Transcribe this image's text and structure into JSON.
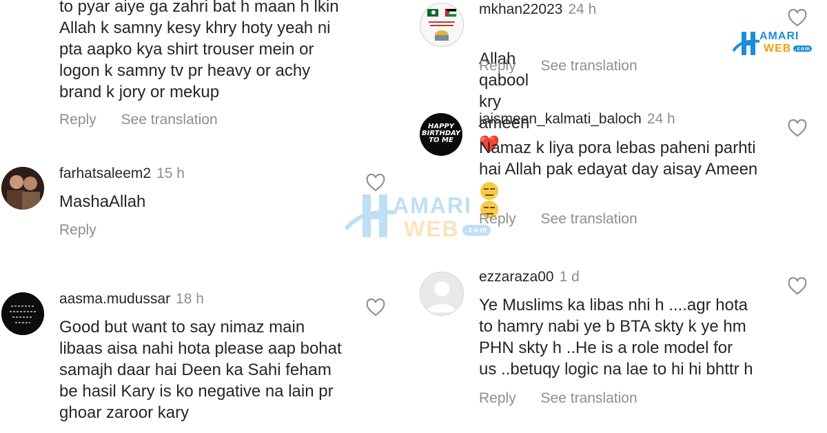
{
  "left_comments": [
    {
      "username": "",
      "time": "",
      "text": "to pyar aiye ga zahri bat h maan h lkin\nAllah k samny kesy khry hoty yeah ni\npta aapko kya shirt trouser mein or\nlogon k samny tv pr heavy or achy\nbrand k jory or mekup",
      "reply": "Reply",
      "see_translation": "See translation"
    },
    {
      "username": "farhatsaleem2",
      "time": "15 h",
      "text": "MashaAllah",
      "reply": "Reply"
    },
    {
      "username": "aasma.mudussar",
      "time": "18 h",
      "text": "Good but want to say nimaz main\nlibaas aisa nahi hota please aap bohat\nsamajh daar hai Deen ka Sahi feham\nbe hasil Kary is ko negative na lain pr\nghoar zaroor kary"
    }
  ],
  "right_comments": [
    {
      "username": "mkhan22023",
      "time": "24 h",
      "text": "Allah qabool kry ameen",
      "emoji": "❤️",
      "reply": "Reply",
      "see_translation": "See translation"
    },
    {
      "username": "jaismeen_kalmati_baloch",
      "time": "24 h",
      "text": "Namaz k liya pora lebas paheni parhti\nhai Allah pak edayat day aisay Ameen",
      "reply": "Reply",
      "see_translation": "See translation",
      "avatar_text": "HAPPY\nBIRTHDAY\nTO ME"
    },
    {
      "username": "ezzaraza00",
      "time": "1 d",
      "text": "Ye Muslims ka libas nhi h ....agr hota\nto hamry nabi ye b BTA skty k ye hm\nPHN skty h ..He is a role model for\nus ..betuqy logic na lae to hi hi bhttr h",
      "reply": "Reply",
      "see_translation": "See translation"
    }
  ],
  "watermark": {
    "line1": "AMARI",
    "line2": "WEB",
    "suffix": ".com"
  },
  "colors": {
    "text": "#262626",
    "muted": "#8e8e8e",
    "brand_blue": "#1a8fd8",
    "brand_orange": "#f39c12",
    "heart_red": "#e0245e"
  }
}
